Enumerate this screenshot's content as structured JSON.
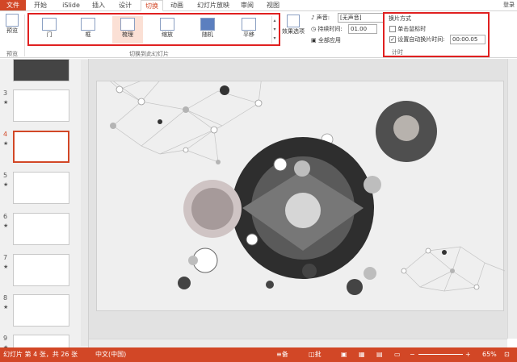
{
  "tabs": [
    "文件",
    "开始",
    "iSlide",
    "插入",
    "设计",
    "切换",
    "动画",
    "幻灯片放映",
    "审阅",
    "视图"
  ],
  "signin": "登录",
  "ribbon": {
    "preview_label": "预览",
    "preview_group": "预览",
    "effects": [
      {
        "label": "门",
        "icon": "door-transition-icon"
      },
      {
        "label": "框",
        "icon": "box-transition-icon"
      },
      {
        "label": "梳理",
        "icon": "comb-transition-icon"
      },
      {
        "label": "缩放",
        "icon": "zoom-transition-icon"
      },
      {
        "label": "随机",
        "icon": "random-transition-icon"
      },
      {
        "label": "平移",
        "icon": "pan-transition-icon"
      }
    ],
    "effects_group": "切换到此幻灯片",
    "effect_options_label": "效果选项",
    "sound_label": "声音:",
    "sound_value": "[无声音]",
    "duration_label": "持续时间:",
    "duration_value": "01.00",
    "apply_all_label": "全部应用",
    "advance_title": "换片方式",
    "on_click_label": "单击鼠标时",
    "on_click_checked": false,
    "auto_label": "设置自动换片时间:",
    "auto_checked": true,
    "auto_value": "00:00.05",
    "timing_group": "计时"
  },
  "thumbnails": [
    {
      "number": "3",
      "star": "★"
    },
    {
      "number": "4",
      "star": "★",
      "selected": true
    },
    {
      "number": "5",
      "star": "★"
    },
    {
      "number": "6",
      "star": "★"
    },
    {
      "number": "7",
      "star": "★"
    },
    {
      "number": "8",
      "star": "★"
    },
    {
      "number": "9",
      "star": "★"
    }
  ],
  "status": {
    "slide_info": "幻灯片 第 4 张，共 26 张",
    "language": "中文(中国)",
    "notes_label": "备注",
    "comments_label": "批注",
    "zoom": "65%"
  },
  "colors": {
    "accent": "#d24726",
    "highlight_box": "#e02020"
  }
}
